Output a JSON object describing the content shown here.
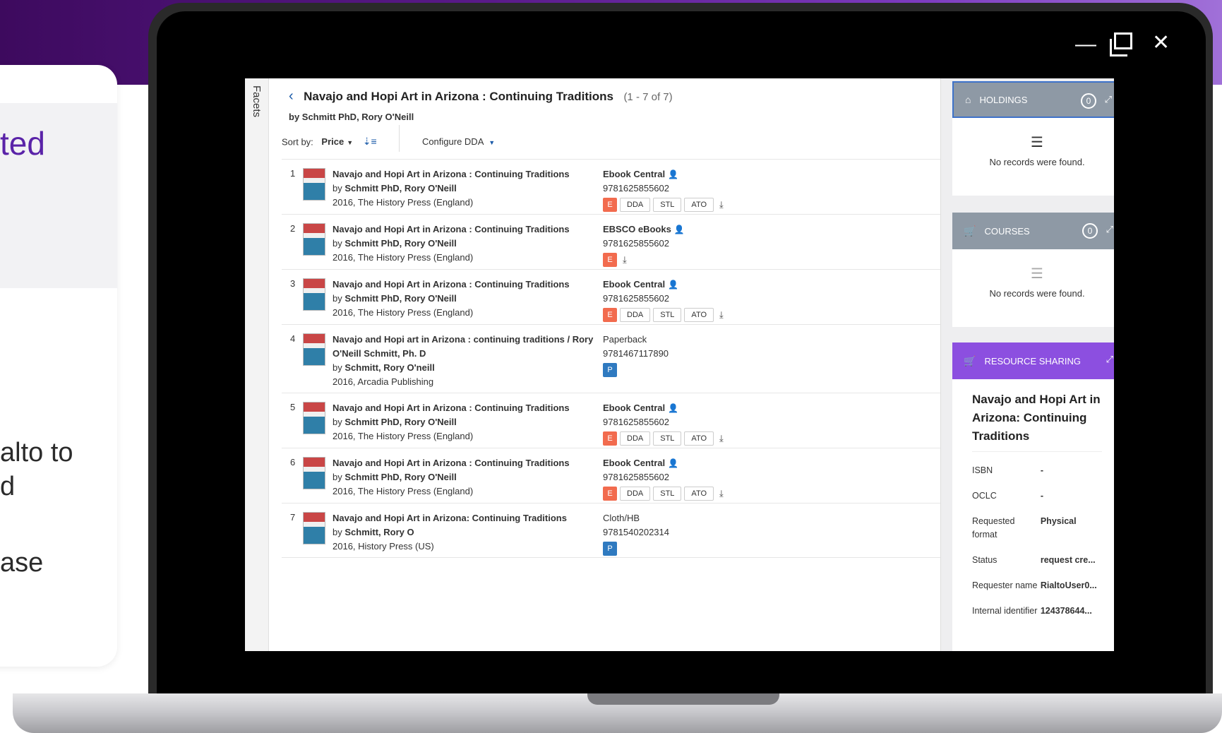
{
  "background_text": {
    "frag_1": "ted",
    "frag_2": "alto to",
    "frag_3": "d",
    "frag_4": "ase"
  },
  "window_controls": {
    "minimize": "—",
    "maximize": "",
    "close": "✕"
  },
  "facets_label": "Facets",
  "header": {
    "title": "Navajo and Hopi Art in Arizona : Continuing Traditions",
    "count": "(1 - 7 of 7)",
    "authors": "by Schmitt PhD, Rory O'Neill"
  },
  "sort": {
    "label": "Sort by:",
    "value": "Price",
    "configure": "Configure DDA"
  },
  "results": [
    {
      "num": "1",
      "title": "Navajo and Hopi Art in Arizona : Continuing Traditions",
      "by": "by",
      "author": "Schmitt PhD, Rory O'Neill",
      "publication": "2016, The History Press (England)",
      "platform": "Ebook Central",
      "isbn": "9781625855602",
      "badge": "E",
      "tags": [
        "DDA",
        "STL",
        "ATO"
      ]
    },
    {
      "num": "2",
      "title": "Navajo and Hopi Art in Arizona : Continuing Traditions",
      "by": "by",
      "author": "Schmitt PhD, Rory O'Neill",
      "publication": "2016, The History Press (England)",
      "platform": "EBSCO eBooks",
      "isbn": "9781625855602",
      "badge": "E",
      "tags": []
    },
    {
      "num": "3",
      "title": "Navajo and Hopi Art in Arizona : Continuing Traditions",
      "by": "by",
      "author": "Schmitt PhD, Rory O'Neill",
      "publication": "2016, The History Press (England)",
      "platform": "Ebook Central",
      "isbn": "9781625855602",
      "badge": "E",
      "tags": [
        "DDA",
        "STL",
        "ATO"
      ]
    },
    {
      "num": "4",
      "title": "Navajo and Hopi art in Arizona : continuing traditions / Rory O'Neill Schmitt, Ph. D",
      "by": "by",
      "author": "Schmitt, Rory O'neill",
      "publication": "2016, Arcadia Publishing",
      "platform": "Paperback",
      "isbn": "9781467117890",
      "badge": "P",
      "tags": []
    },
    {
      "num": "5",
      "title": "Navajo and Hopi Art in Arizona : Continuing Traditions",
      "by": "by",
      "author": "Schmitt PhD, Rory O'Neill",
      "publication": "2016, The History Press (England)",
      "platform": "Ebook Central",
      "isbn": "9781625855602",
      "badge": "E",
      "tags": [
        "DDA",
        "STL",
        "ATO"
      ]
    },
    {
      "num": "6",
      "title": "Navajo and Hopi Art in Arizona : Continuing Traditions",
      "by": "by",
      "author": "Schmitt PhD, Rory O'Neill",
      "publication": "2016, The History Press (England)",
      "platform": "Ebook Central",
      "isbn": "9781625855602",
      "badge": "E",
      "tags": [
        "DDA",
        "STL",
        "ATO"
      ]
    },
    {
      "num": "7",
      "title": "Navajo and Hopi Art in Arizona: Continuing Traditions",
      "by": "by",
      "author": "Schmitt, Rory O",
      "publication": "2016, History Press (US)",
      "platform": "Cloth/HB",
      "isbn": "9781540202314",
      "badge": "P",
      "tags": []
    }
  ],
  "holdings": {
    "label": "HOLDINGS",
    "count": "0",
    "empty": "No records were found."
  },
  "courses": {
    "label": "COURSES",
    "count": "0",
    "empty": "No records were found."
  },
  "resource_sharing": {
    "label": "RESOURCE SHARING",
    "title": "Navajo and Hopi Art in Arizona: Continuing Traditions",
    "fields": [
      {
        "key": "ISBN",
        "value": "-"
      },
      {
        "key": "OCLC",
        "value": "-"
      },
      {
        "key": "Requested format",
        "value": "Physical"
      },
      {
        "key": "Status",
        "value": "request cre..."
      },
      {
        "key": "Requester name",
        "value": "RialtoUser0..."
      },
      {
        "key": "Internal identifier",
        "value": "124378644..."
      }
    ]
  },
  "colors": {
    "accent_blue": "#1a5aa8",
    "ebook_badge": "#f26b4e",
    "print_badge": "#2f7ac0",
    "panel_header": "#8e99a5",
    "resource_sharing_header": "#8c4fe0"
  }
}
